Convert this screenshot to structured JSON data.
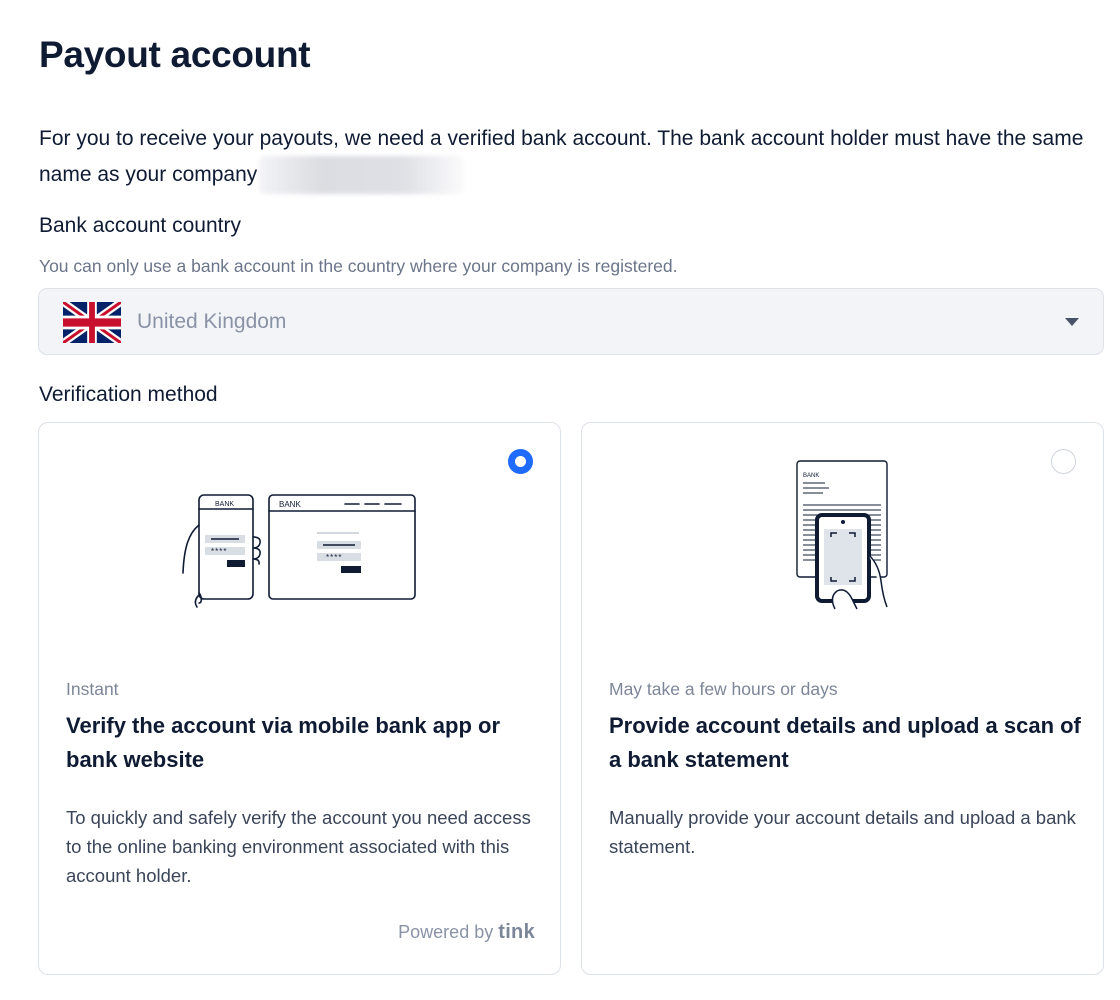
{
  "page": {
    "title": "Payout account",
    "intro": "For you to receive your payouts, we need a verified bank account. The bank account holder must have the same name as your company"
  },
  "country": {
    "label": "Bank account country",
    "help": "You can only use a bank account in the country where your company is registered.",
    "selected": "United Kingdom",
    "flag_icon": "uk-flag-icon"
  },
  "verification": {
    "label": "Verification method",
    "options": [
      {
        "selected": true,
        "meta": "Instant",
        "title": "Verify the account via mobile bank app or bank website",
        "description": "To quickly and safely verify the account you need access to the online banking environment associated with this account holder.",
        "powered_prefix": "Powered by",
        "powered_brand": "tink",
        "illustration": "phone-and-browser-bank-illustration",
        "illus_phone_bank": "BANK",
        "illus_browser_bank": "BANK",
        "illus_phone_mask": "****",
        "illus_browser_mask": "****"
      },
      {
        "selected": false,
        "meta": "May take a few hours or days",
        "title": "Provide account details and upload a scan of a bank statement",
        "description": "Manually provide your account details and upload a bank statement.",
        "illustration": "scan-statement-illustration",
        "illus_doc_bank": "BANK"
      }
    ]
  },
  "colors": {
    "accent": "#1f6bff",
    "text": "#0f1b33",
    "muted": "#6b7589",
    "select_bg": "#f2f4f8",
    "border": "#dde1e8"
  }
}
